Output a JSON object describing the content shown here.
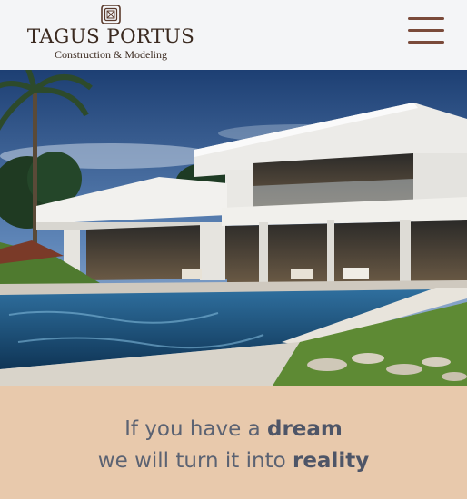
{
  "brand": {
    "name": "TAGUS PORTUS",
    "tagline": "Construction & Modeling"
  },
  "hero": {
    "image": "modern-white-villa-with-pool"
  },
  "headline": {
    "line1_pre": "If you have a ",
    "line1_em": "dream",
    "line2_pre": "we will turn it into ",
    "line2_em": "reality"
  },
  "colors": {
    "brand_brown": "#3b2a20",
    "menu_accent": "#7a4a3a",
    "band_bg": "#e8c9ac",
    "headline_text": "#5b6272"
  },
  "icons": {
    "logo": "diamond-frame-logo-icon",
    "menu": "hamburger-menu-icon"
  }
}
